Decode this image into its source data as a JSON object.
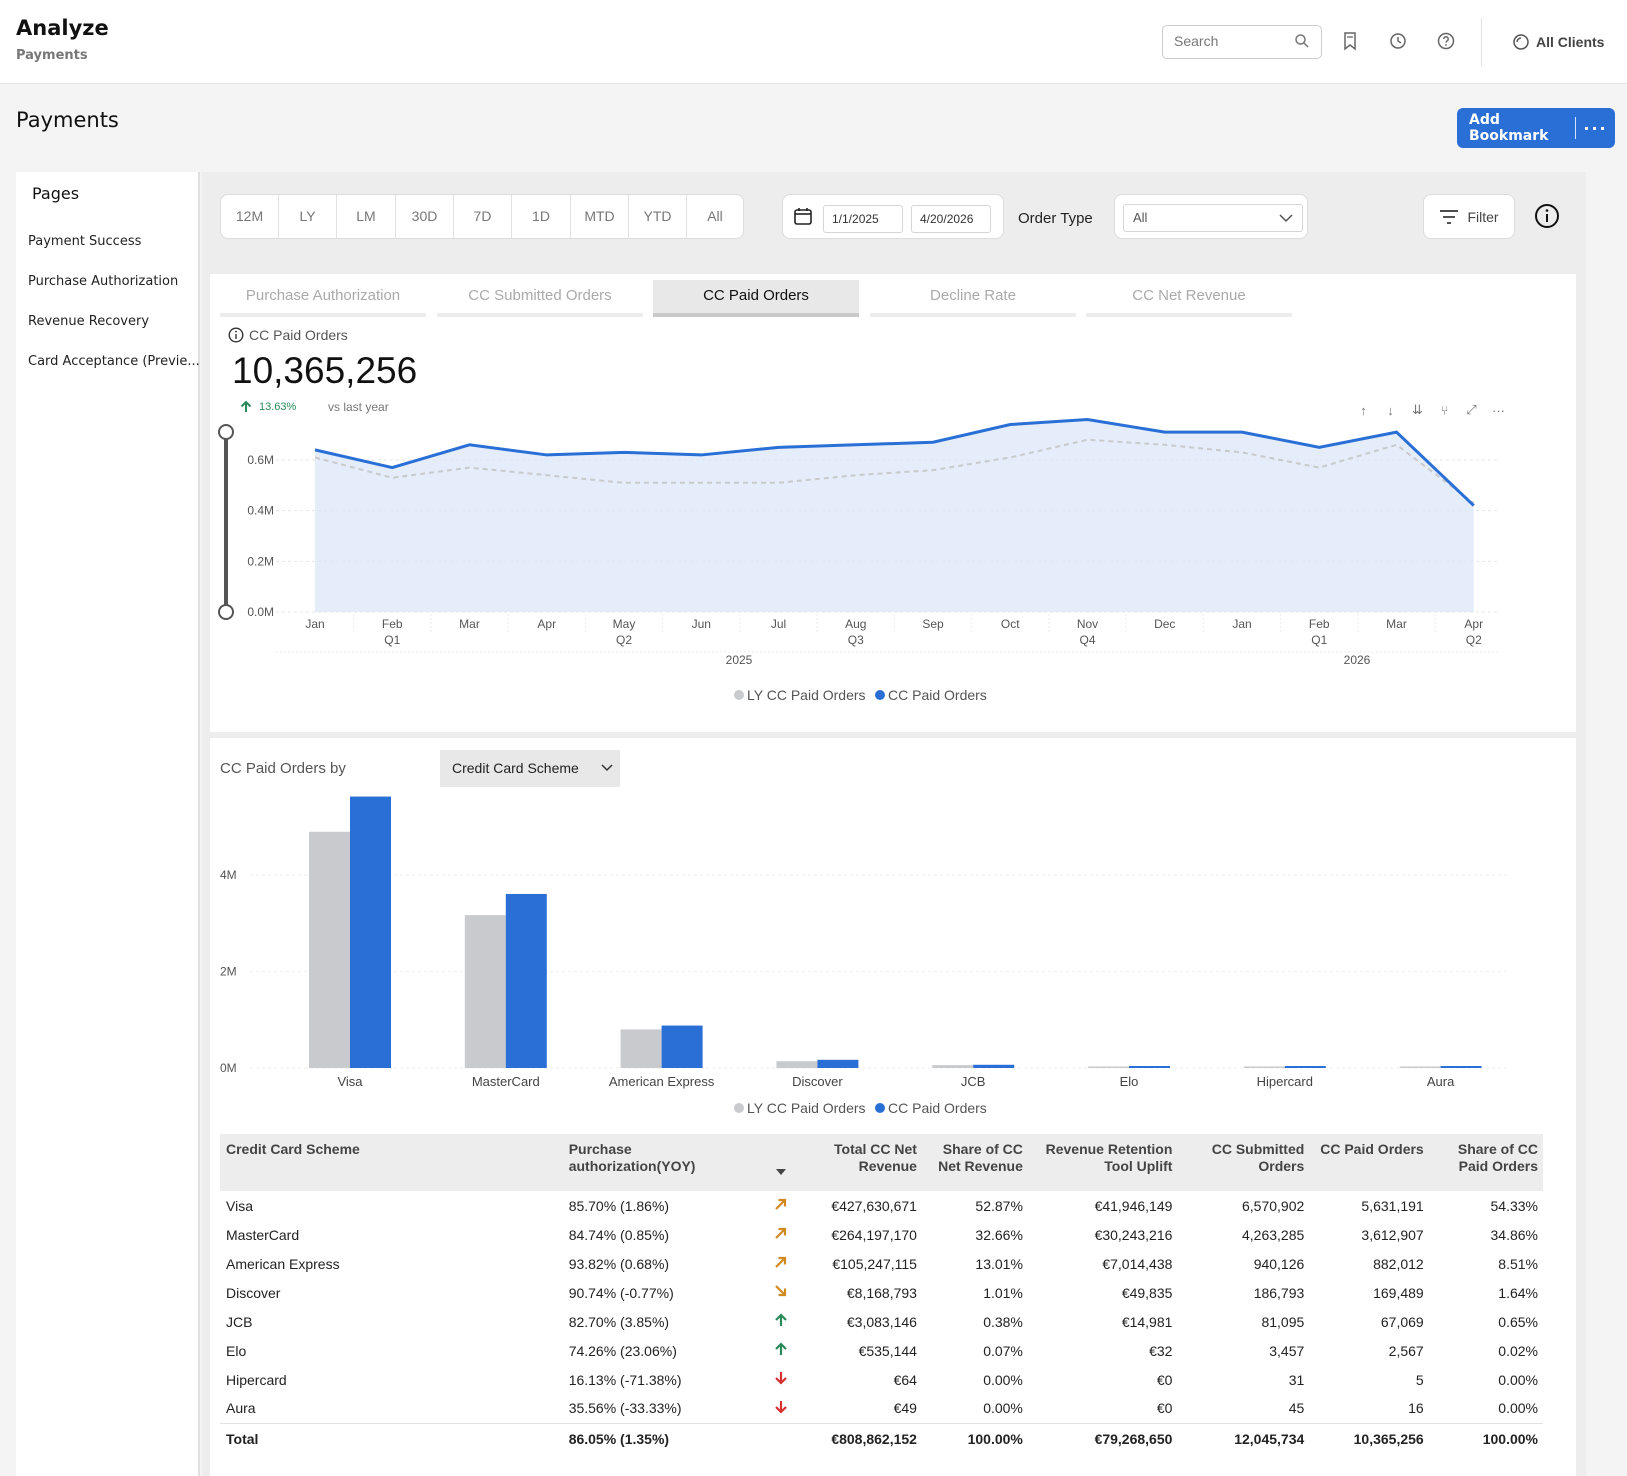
{
  "header": {
    "app_title": "Analyze",
    "app_subtitle": "Payments",
    "search_placeholder": "Search",
    "clients_label": "All Clients",
    "icons": [
      "search-icon",
      "bookmark-icon",
      "history-icon",
      "help-icon",
      "clients-icon"
    ]
  },
  "page": {
    "title": "Payments",
    "add_bookmark_label": "Add Bookmark",
    "more_label": "···"
  },
  "sidebar": {
    "heading": "Pages",
    "items": [
      {
        "label": "Payment Success"
      },
      {
        "label": "Purchase Authorization"
      },
      {
        "label": "Revenue Recovery"
      },
      {
        "label": "Card Acceptance (Previe..."
      }
    ]
  },
  "filters": {
    "periods": [
      "12M",
      "LY",
      "LM",
      "30D",
      "7D",
      "1D",
      "MTD",
      "YTD",
      "All"
    ],
    "start_date": "1/1/2025",
    "end_date": "4/20/2026",
    "order_type_label": "Order Type",
    "order_type_value": "All",
    "filter_label": "Filter"
  },
  "tabs": [
    {
      "label": "Purchase Authorization",
      "active": false
    },
    {
      "label": "CC Submitted Orders",
      "active": false
    },
    {
      "label": "CC Paid Orders",
      "active": true
    },
    {
      "label": "Decline Rate",
      "active": false
    },
    {
      "label": "CC Net Revenue",
      "active": false
    }
  ],
  "kpi": {
    "label": "CC Paid Orders",
    "value": "10,365,256",
    "delta": "13.63%",
    "vs": "vs last year"
  },
  "colors": {
    "accent": "#2a6fd6",
    "ly_series": "#c8cacd",
    "area_fill": "#dde9f7",
    "positive": "#2a8a5a",
    "negative": "#d83030",
    "trend_up_mild": "#d08a20"
  },
  "line_chart": {
    "chart_data": {
      "type": "area",
      "y_ticks": [
        "0.0M",
        "0.2M",
        "0.4M",
        "0.6M"
      ],
      "ylim": [
        0,
        0.75
      ],
      "x_months": [
        "Jan",
        "Feb",
        "Mar",
        "Apr",
        "May",
        "Jun",
        "Jul",
        "Aug",
        "Sep",
        "Oct",
        "Nov",
        "Dec",
        "Jan",
        "Feb",
        "Mar",
        "Apr"
      ],
      "x_quarters": [
        "",
        "Q1",
        "",
        "",
        "Q2",
        "",
        "",
        "Q3",
        "",
        "",
        "Q4",
        "",
        "",
        "Q1",
        "",
        "Q2"
      ],
      "x_years": [
        "2025",
        "2026"
      ],
      "series": [
        {
          "name": "LY CC Paid Orders",
          "style": "dashed",
          "values": [
            0.61,
            0.53,
            0.57,
            0.54,
            0.51,
            0.51,
            0.51,
            0.54,
            0.56,
            0.61,
            0.68,
            0.66,
            0.63,
            0.57,
            0.66,
            0.43
          ]
        },
        {
          "name": "CC Paid Orders",
          "style": "solid",
          "values": [
            0.64,
            0.57,
            0.66,
            0.62,
            0.63,
            0.62,
            0.65,
            0.66,
            0.67,
            0.74,
            0.76,
            0.71,
            0.71,
            0.65,
            0.71,
            0.42
          ]
        }
      ]
    }
  },
  "bar_section": {
    "by_label": "CC Paid Orders by",
    "dimension": "Credit Card Scheme",
    "chart_data": {
      "type": "bar",
      "y_ticks": [
        "0M",
        "2M",
        "4M"
      ],
      "ylim": [
        0,
        5.6
      ],
      "categories": [
        "Visa",
        "MasterCard",
        "American Express",
        "Discover",
        "JCB",
        "Elo",
        "Hipercard",
        "Aura"
      ],
      "series": [
        {
          "name": "LY CC Paid Orders",
          "values": [
            4.9,
            3.17,
            0.8,
            0.14,
            0.06,
            0.002,
            0.0,
            0.0
          ]
        },
        {
          "name": "CC Paid Orders",
          "values": [
            5.63,
            3.61,
            0.88,
            0.17,
            0.067,
            0.003,
            0.0,
            0.0
          ]
        }
      ]
    }
  },
  "legend": [
    {
      "label": "LY CC Paid Orders"
    },
    {
      "label": "CC Paid Orders"
    }
  ],
  "table": {
    "headers": [
      "Credit Card Scheme",
      "Purchase authorization(YOY)",
      "",
      "Total CC Net Revenue",
      "Share of CC Net Revenue",
      "Revenue Retention Tool Uplift",
      "CC Submitted Orders",
      "CC Paid Orders",
      "Share of CC Paid Orders"
    ],
    "rows": [
      {
        "scheme": "Visa",
        "pa": "85.70% (1.86%)",
        "trend": "up-mild",
        "net": "€427,630,671",
        "share_net": "52.87%",
        "uplift": "€41,946,149",
        "submitted": "6,570,902",
        "paid": "5,631,191",
        "share_paid": "54.33%"
      },
      {
        "scheme": "MasterCard",
        "pa": "84.74% (0.85%)",
        "trend": "up-mild",
        "net": "€264,197,170",
        "share_net": "32.66%",
        "uplift": "€30,243,216",
        "submitted": "4,263,285",
        "paid": "3,612,907",
        "share_paid": "34.86%"
      },
      {
        "scheme": "American Express",
        "pa": "93.82% (0.68%)",
        "trend": "up-mild",
        "net": "€105,247,115",
        "share_net": "13.01%",
        "uplift": "€7,014,438",
        "submitted": "940,126",
        "paid": "882,012",
        "share_paid": "8.51%"
      },
      {
        "scheme": "Discover",
        "pa": "90.74% (-0.77%)",
        "trend": "down-mild",
        "net": "€8,168,793",
        "share_net": "1.01%",
        "uplift": "€49,835",
        "submitted": "186,793",
        "paid": "169,489",
        "share_paid": "1.64%"
      },
      {
        "scheme": "JCB",
        "pa": "82.70% (3.85%)",
        "trend": "up",
        "net": "€3,083,146",
        "share_net": "0.38%",
        "uplift": "€14,981",
        "submitted": "81,095",
        "paid": "67,069",
        "share_paid": "0.65%"
      },
      {
        "scheme": "Elo",
        "pa": "74.26% (23.06%)",
        "trend": "up",
        "net": "€535,144",
        "share_net": "0.07%",
        "uplift": "€32",
        "submitted": "3,457",
        "paid": "2,567",
        "share_paid": "0.02%"
      },
      {
        "scheme": "Hipercard",
        "pa": "16.13% (-71.38%)",
        "trend": "down",
        "net": "€64",
        "share_net": "0.00%",
        "uplift": "€0",
        "submitted": "31",
        "paid": "5",
        "share_paid": "0.00%"
      },
      {
        "scheme": "Aura",
        "pa": "35.56% (-33.33%)",
        "trend": "down",
        "net": "€49",
        "share_net": "0.00%",
        "uplift": "€0",
        "submitted": "45",
        "paid": "16",
        "share_paid": "0.00%"
      }
    ],
    "total": {
      "scheme": "Total",
      "pa": "86.05% (1.35%)",
      "net": "€808,862,152",
      "share_net": "100.00%",
      "uplift": "€79,268,650",
      "submitted": "12,045,734",
      "paid": "10,365,256",
      "share_paid": "100.00%"
    }
  }
}
